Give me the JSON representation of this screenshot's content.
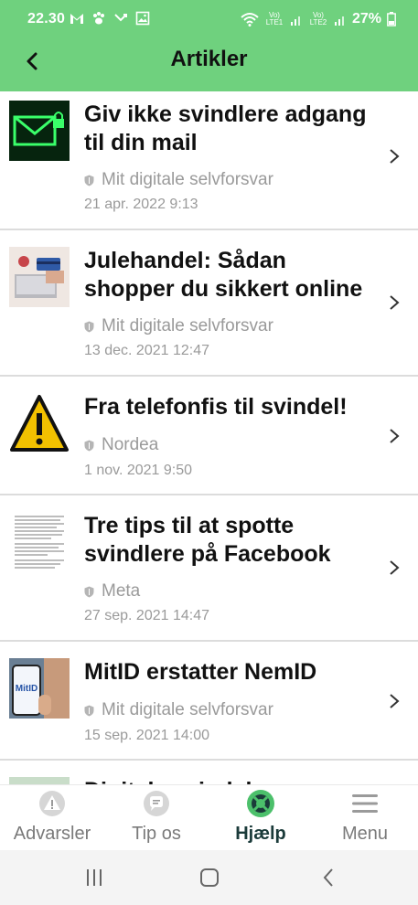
{
  "status_bar": {
    "time": "22.30",
    "lte1": "Vo) LTE1",
    "lte2": "Vo) LTE2",
    "battery": "27%"
  },
  "header": {
    "title": "Artikler"
  },
  "articles": [
    {
      "title": "Giv ikke svindlere adgang til din mail",
      "source": "Mit digitale selvforsvar",
      "date": "21 apr. 2022 9:13",
      "thumbnail": "mail-lock-image"
    },
    {
      "title": "Julehandel: Sådan shopper du sikkert online",
      "source": "Mit digitale selvforsvar",
      "date": "13 dec. 2021 12:47",
      "thumbnail": "online-shopping-image"
    },
    {
      "title": "Fra telefonfis til svindel!",
      "source": "Nordea",
      "date": "1 nov. 2021 9:50",
      "thumbnail": "warning-sign-image"
    },
    {
      "title": "Tre tips til at spotte svindlere på Facebook",
      "source": "Meta",
      "date": "27 sep. 2021 14:47",
      "thumbnail": "document-text-image"
    },
    {
      "title": "MitID erstatter NemID",
      "source": "Mit digitale selvforsvar",
      "date": "15 sep. 2021 14:00",
      "thumbnail": "mitid-phone-image"
    }
  ],
  "partial_article": {
    "title": "Digitale svindel..."
  },
  "bottom_nav": {
    "items": [
      {
        "label": "Advarsler",
        "icon": "warning-icon"
      },
      {
        "label": "Tip os",
        "icon": "chat-icon"
      },
      {
        "label": "Hjælp",
        "icon": "help-icon",
        "active": true
      },
      {
        "label": "Menu",
        "icon": "menu-icon"
      }
    ]
  },
  "colors": {
    "header_green": "#6fd17e",
    "active_green": "#4cc06b"
  }
}
